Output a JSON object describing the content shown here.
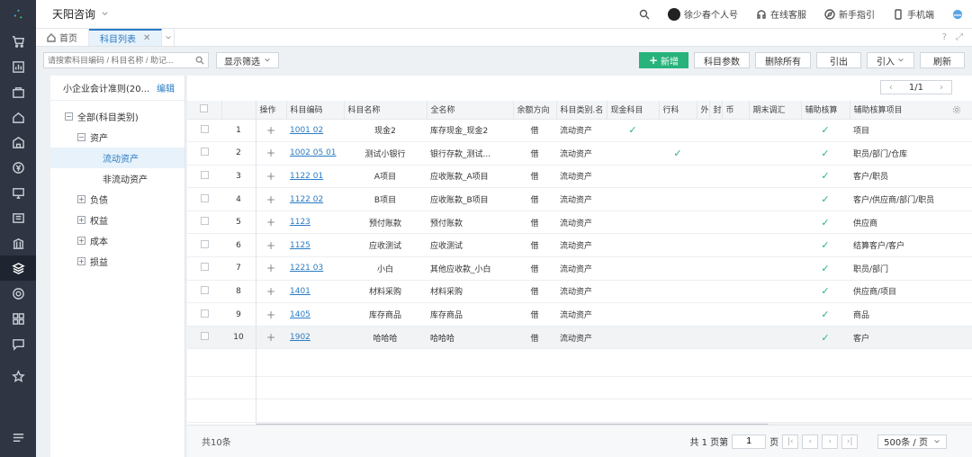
{
  "app": {
    "company": "天阳咨询"
  },
  "topbar": {
    "user": "徐少春个人号",
    "service": "在线客服",
    "guide": "新手指引",
    "mobile": "手机端"
  },
  "tabs": [
    {
      "label": "首页"
    },
    {
      "label": "科目列表"
    }
  ],
  "toolbar": {
    "search_placeholder": "请搜索科目编码 / 科目名称 / 助记...",
    "filter_label": "显示筛选",
    "buttons": {
      "new": "新增",
      "params": "科目参数",
      "delete_all": "删除所有",
      "export": "引出",
      "import": "引入",
      "refresh": "刷新"
    }
  },
  "panel": {
    "title": "小企业会计准则(20...",
    "edit": "编辑",
    "tree": [
      {
        "label": "全部(科目类别)",
        "box": "−"
      },
      {
        "label": "资产",
        "box": "−"
      },
      {
        "label": "流动资产",
        "box": ""
      },
      {
        "label": "非流动资产",
        "box": ""
      },
      {
        "label": "负债",
        "box": "+"
      },
      {
        "label": "权益",
        "box": "+"
      },
      {
        "label": "成本",
        "box": "+"
      },
      {
        "label": "损益",
        "box": "+"
      }
    ]
  },
  "pager_top": {
    "page": "1/1"
  },
  "table": {
    "headers": [
      "操作",
      "科目编码",
      "科目名称",
      "全名称",
      "余额方向",
      "科目类别.名",
      "现金科目",
      "行科",
      "外",
      "封",
      "币",
      "期末调汇",
      "辅助核算",
      "辅助核算项目"
    ],
    "rows": [
      {
        "n": "1",
        "code": "1001 02",
        "name": "现金2",
        "full": "库存现金_现金2",
        "dir": "借",
        "cat": "流动资产",
        "cash": "✓",
        "bank": "",
        "aux": "✓",
        "items": "项目"
      },
      {
        "n": "2",
        "code": "1002 05 01",
        "name": "测试小银行",
        "full": "银行存款_测试...",
        "dir": "借",
        "cat": "流动资产",
        "cash": "",
        "bank": "✓",
        "aux": "✓",
        "items": "职员/部门/仓库"
      },
      {
        "n": "3",
        "code": "1122 01",
        "name": "A项目",
        "full": "应收账款_A项目",
        "dir": "借",
        "cat": "流动资产",
        "cash": "",
        "bank": "",
        "aux": "✓",
        "items": "客户/职员"
      },
      {
        "n": "4",
        "code": "1122 02",
        "name": "B项目",
        "full": "应收账款_B项目",
        "dir": "借",
        "cat": "流动资产",
        "cash": "",
        "bank": "",
        "aux": "✓",
        "items": "客户/供应商/部门/职员"
      },
      {
        "n": "5",
        "code": "1123",
        "name": "预付账款",
        "full": "预付账款",
        "dir": "借",
        "cat": "流动资产",
        "cash": "",
        "bank": "",
        "aux": "✓",
        "items": "供应商"
      },
      {
        "n": "6",
        "code": "1125",
        "name": "应收测试",
        "full": "应收测试",
        "dir": "借",
        "cat": "流动资产",
        "cash": "",
        "bank": "",
        "aux": "✓",
        "items": "结算客户/客户"
      },
      {
        "n": "7",
        "code": "1221 03",
        "name": "小白",
        "full": "其他应收款_小白",
        "dir": "借",
        "cat": "流动资产",
        "cash": "",
        "bank": "",
        "aux": "✓",
        "items": "职员/部门"
      },
      {
        "n": "8",
        "code": "1401",
        "name": "材料采购",
        "full": "材料采购",
        "dir": "借",
        "cat": "流动资产",
        "cash": "",
        "bank": "",
        "aux": "✓",
        "items": "供应商/项目"
      },
      {
        "n": "9",
        "code": "1405",
        "name": "库存商品",
        "full": "库存商品",
        "dir": "借",
        "cat": "流动资产",
        "cash": "",
        "bank": "",
        "aux": "✓",
        "items": "商品"
      },
      {
        "n": "10",
        "code": "1902",
        "name": "哈哈哈",
        "full": "哈哈哈",
        "dir": "借",
        "cat": "流动资产",
        "cash": "",
        "bank": "",
        "aux": "✓",
        "items": "客户"
      }
    ]
  },
  "footer": {
    "total": "共10条",
    "pages_prefix": "共 1 页第",
    "page_value": "1",
    "page_suffix": "页",
    "page_size": "500条 / 页"
  }
}
